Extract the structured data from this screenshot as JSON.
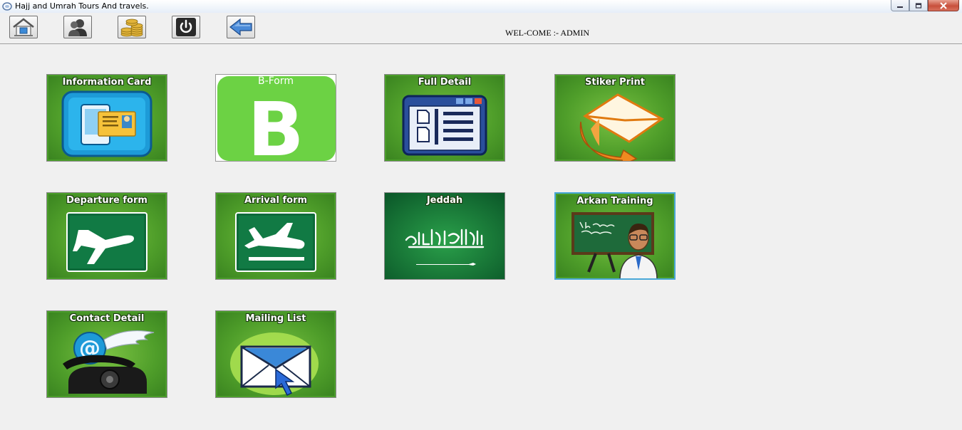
{
  "window": {
    "title": "Hajj and Umrah Tours And travels."
  },
  "toolbar": {
    "buttons": [
      {
        "name": "home-button",
        "icon": "home-icon"
      },
      {
        "name": "users-button",
        "icon": "user-icon"
      },
      {
        "name": "payments-button",
        "icon": "coins-icon"
      },
      {
        "name": "power-button",
        "icon": "power-icon"
      },
      {
        "name": "back-button",
        "icon": "back-arrow-icon"
      }
    ],
    "welcome": "WEL-COME :- ADMIN"
  },
  "tiles": {
    "information_card": "Information Card",
    "b_form": "B-Form",
    "b_form_letter": "B",
    "full_detail": "Full Detail",
    "stiker_print": "Stiker  Print",
    "departure_form": "Departure form",
    "arrival_form": "Arrival form",
    "jeddah": "Jeddah",
    "arkan_training": "Arkan Training",
    "contact_detail": "Contact Detail",
    "mailing_list": "Mailing List"
  },
  "colors": {
    "tile_green": "#4f9e2a",
    "selected_border": "#4aa8d8",
    "close_button": "#c8503c"
  }
}
